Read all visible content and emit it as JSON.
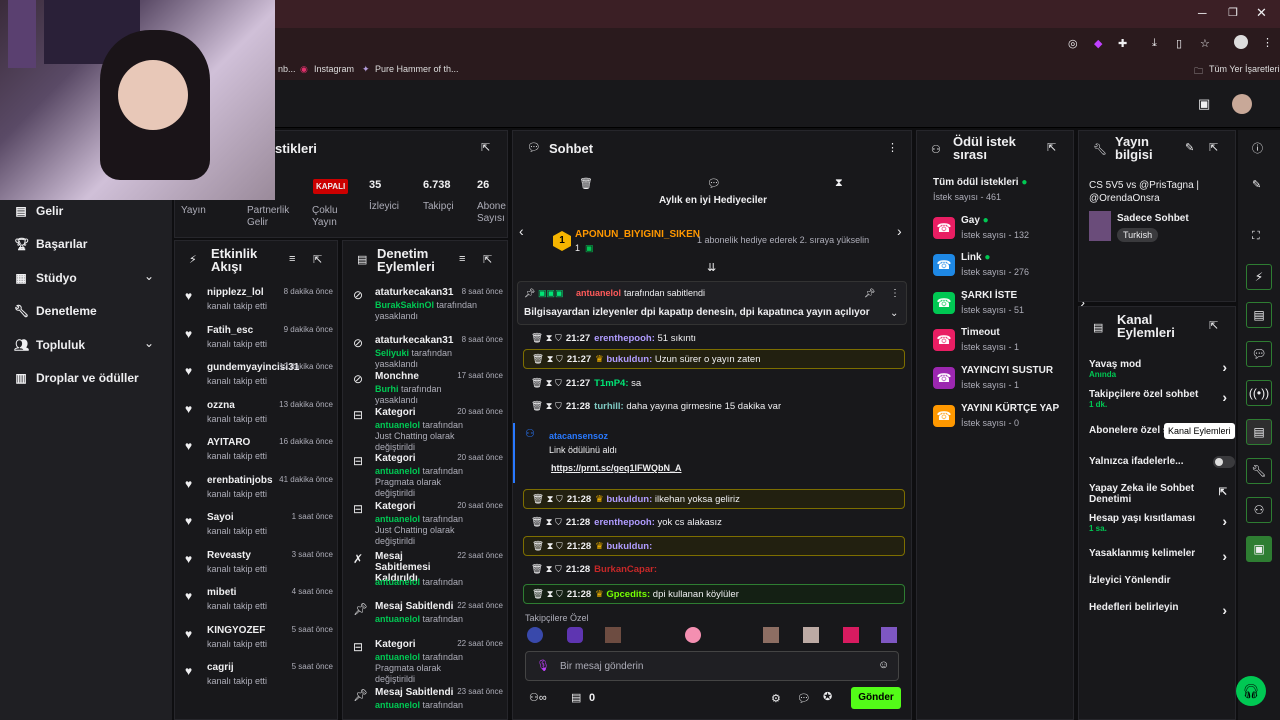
{
  "browser": {
    "bookmarks": [
      "nb...",
      "Instagram",
      "Pure Hammer of th..."
    ],
    "all_bookmarks": "Tüm Yer İşaretleri"
  },
  "nav": {
    "items": [
      {
        "label": "Gelir",
        "icon": "money-icon"
      },
      {
        "label": "Başarılar",
        "icon": "trophy-icon"
      },
      {
        "label": "Stüdyo",
        "icon": "studio-icon"
      },
      {
        "label": "Denetleme",
        "icon": "wrench-icon"
      },
      {
        "label": "Topluluk",
        "icon": "people-icon"
      },
      {
        "label": "Droplar ve ödüller",
        "icon": "drops-icon"
      }
    ]
  },
  "stats": {
    "title": "stikleri",
    "items": [
      {
        "value": "",
        "label": "Yayın"
      },
      {
        "value": "",
        "label": "Partnerlik Gelir"
      },
      {
        "value": "KAPALI",
        "label": "Çoklu Yayın"
      },
      {
        "value": "35",
        "label": "İzleyici"
      },
      {
        "value": "6.738",
        "label": "Takipçi"
      },
      {
        "value": "26",
        "label": "Abone Sayısı"
      }
    ]
  },
  "activity": {
    "title": "Etkinlik Akışı",
    "items": [
      {
        "name": "nipplezz_lol",
        "sub": "kanalı takip etti",
        "time": "8 dakika önce"
      },
      {
        "name": "Fatih_esc",
        "sub": "kanalı takip etti",
        "time": "9 dakika önce"
      },
      {
        "name": "gundemyayincisi31",
        "sub": "kanalı takip etti",
        "time": "12 dakika önce"
      },
      {
        "name": "ozzna",
        "sub": "kanalı takip etti",
        "time": "13 dakika önce"
      },
      {
        "name": "AYITARO",
        "sub": "kanalı takip etti",
        "time": "16 dakika önce"
      },
      {
        "name": "erenbatinjobs",
        "sub": "kanalı takip etti",
        "time": "41 dakika önce"
      },
      {
        "name": "Sayoi",
        "sub": "kanalı takip etti",
        "time": "1 saat önce"
      },
      {
        "name": "Reveasty",
        "sub": "kanalı takip etti",
        "time": "3 saat önce"
      },
      {
        "name": "mibeti",
        "sub": "kanalı takip etti",
        "time": "4 saat önce"
      },
      {
        "name": "KINGYOZEF",
        "sub": "kanalı takip etti",
        "time": "5 saat önce"
      },
      {
        "name": "cagrij",
        "sub": "kanalı takip etti",
        "time": "5 saat önce"
      }
    ]
  },
  "moderation": {
    "title": "Denetim Eylemleri",
    "items": [
      {
        "name": "ataturkecakan31",
        "who": "BurakSakinOl",
        "sub": " tarafından yasaklandı",
        "time": "8 saat önce"
      },
      {
        "name": "ataturkecakan31",
        "who": "Seliyuki",
        "sub": " tarafından yasaklandı",
        "time": "8 saat önce"
      },
      {
        "name": "Monchne",
        "who": "Burhi",
        "sub": " tarafından yasaklandı",
        "time": "17 saat önce"
      },
      {
        "name": "Kategori",
        "who": "antuanelol",
        "sub": " tarafından Just Chatting olarak değiştirildi",
        "time": "20 saat önce"
      },
      {
        "name": "Kategori",
        "who": "antuanelol",
        "sub": " tarafından Pragmata olarak değiştirildi",
        "time": "20 saat önce"
      },
      {
        "name": "Kategori",
        "who": "antuanelol",
        "sub": " tarafından Just Chatting olarak değiştirildi",
        "time": "20 saat önce"
      },
      {
        "name": "Mesaj Sabitlemesi Kaldırıldı",
        "who": "antuanelol",
        "sub": " tarafından",
        "time": "22 saat önce"
      },
      {
        "name": "Mesaj Sabitlendi",
        "who": "antuanelol",
        "sub": " tarafından",
        "time": "22 saat önce"
      },
      {
        "name": "Kategori",
        "who": "antuanelol",
        "sub": " tarafından Pragmata olarak değiştirildi",
        "time": "22 saat önce"
      },
      {
        "name": "Mesaj Sabitlendi",
        "who": "antuanelol",
        "sub": " tarafından",
        "time": "23 saat önce"
      }
    ]
  },
  "chat": {
    "title": "Sohbet",
    "leaderboard_title": "Aylık en iyi Hediyeciler",
    "top_gifter": "APONUN_BIYIGINI_SIKEN",
    "top_gifter_count": "1",
    "top_gifter_rank": "1",
    "gift_hint": "1 abonelik hediye ederek 2. sıraya yükselin",
    "pinned_by": "antuanelol",
    "pinned_label": "tarafından sabitlendi",
    "pinned_text": "Bilgisayardan izleyenler dpi kapatıp denesin, dpi kapatınca yayın açılıyor",
    "messages": [
      {
        "time": "21:27",
        "user": "erenthepooh:",
        "text": " 51 sıkıntı",
        "color": "#b09cff",
        "hl": ""
      },
      {
        "time": "21:27",
        "user": "bukuldun:",
        "text": " Uzun sürer o yayın zaten",
        "color": "#b09cff",
        "hl": "y"
      },
      {
        "time": "21:27",
        "user": "T1mP4:",
        "text": " sa",
        "color": "#00e676",
        "hl": ""
      },
      {
        "time": "21:28",
        "user": "turhill:",
        "text": " daha yayına girmesine 15 dakika var",
        "color": "#80cbc4",
        "hl": ""
      },
      {
        "time": "21:28",
        "user": "bukuldun:",
        "text": " ilkehan yoksa geliriz",
        "color": "#b09cff",
        "hl": "y"
      },
      {
        "time": "21:28",
        "user": "erenthepooh:",
        "text": " yok cs alakasız",
        "color": "#b09cff",
        "hl": ""
      },
      {
        "time": "21:28",
        "user": "bukuldun:",
        "text": "",
        "color": "#b09cff",
        "hl": "y"
      },
      {
        "time": "21:28",
        "user": "BurkanCapar:",
        "text": "",
        "color": "#c62828",
        "hl": ""
      },
      {
        "time": "21:28",
        "user": "Gpcedits:",
        "text": " dpi kullanan köylüler",
        "color": "#76ff03",
        "hl": "g"
      }
    ],
    "reward_user": "atacansensoz",
    "reward_text": "Link ödülünü aldı",
    "reward_link": "https://prnt.sc/geq1lFWQbN_A",
    "followers_only": "Takipçilere Özel",
    "input_placeholder": "Bir mesaj gönderin",
    "points": "0",
    "send": "Gönder"
  },
  "rewards": {
    "title": "Ödül istek sırası",
    "items": [
      {
        "name": "Tüm ödül istekleri",
        "count": "İstek sayısı - 461",
        "color": "",
        "dot": true
      },
      {
        "name": "Gay",
        "count": "İstek sayısı - 132",
        "color": "#e91e63",
        "dot": true
      },
      {
        "name": "Link",
        "count": "İstek sayısı - 276",
        "color": "#1e88e5",
        "dot": true
      },
      {
        "name": "ŞARKI İSTE",
        "count": "İstek sayısı - 51",
        "color": "#00c853",
        "dot": false
      },
      {
        "name": "Timeout",
        "count": "İstek sayısı - 1",
        "color": "#e91e63",
        "dot": false
      },
      {
        "name": "YAYINCIYI SUSTUR",
        "count": "İstek sayısı - 1",
        "color": "#9c27b0",
        "dot": false
      },
      {
        "name": "YAYINI KÜRTÇE YAP",
        "count": "İstek sayısı - 0",
        "color": "#ff9800",
        "dot": false
      }
    ]
  },
  "stream_info": {
    "title": "Yayın bilgisi",
    "stream_title": "CS 5V5 vs @PrisTagna | @OrendaOnsra",
    "category": "Sadece Sohbet",
    "language": "Turkish"
  },
  "channel_actions": {
    "title": "Kanal Eylemleri",
    "tooltip": "Kanal Eylemleri",
    "items": [
      {
        "label": "Yavaş mod",
        "sub": "Anında",
        "kind": "chevron"
      },
      {
        "label": "Takipçilere özel sohbet",
        "sub": "1 dk.",
        "kind": "chevron"
      },
      {
        "label": "Abonelere özel s",
        "sub": "",
        "kind": "none"
      },
      {
        "label": "Yalnızca ifadelerle...",
        "sub": "",
        "kind": "toggle"
      },
      {
        "label": "Yapay Zeka ile Sohbet Denetimi",
        "sub": "",
        "kind": "external"
      },
      {
        "label": "Hesap yaşı kısıtlaması",
        "sub": "1 sa.",
        "kind": "chevron"
      },
      {
        "label": "Yasaklanmış kelimeler",
        "sub": "",
        "kind": "chevron"
      },
      {
        "label": "İzleyici Yönlendir",
        "sub": "",
        "kind": "none"
      },
      {
        "label": "Hedefleri belirleyin",
        "sub": "",
        "kind": "chevron"
      }
    ]
  },
  "colors": {
    "accent": "#00c853",
    "send": "#53fc18",
    "bg": "#0e0e10",
    "panel": "#18181b"
  }
}
